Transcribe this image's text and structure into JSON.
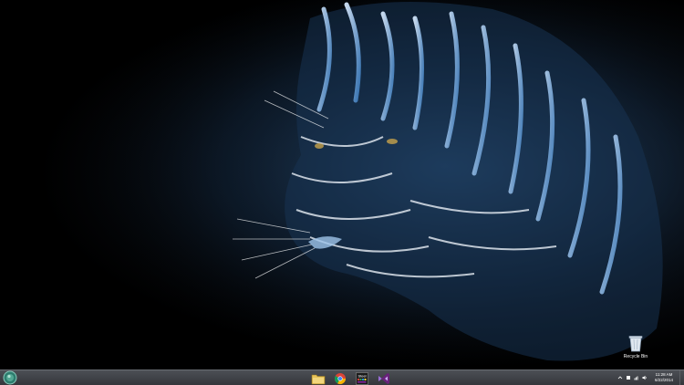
{
  "desktop": {
    "wallpaper": "fractal-tiger-icon",
    "icons": [
      {
        "label": "Recycle Bin",
        "icon": "recycle-bin-icon"
      }
    ]
  },
  "taskbar": {
    "start_icon": "windows-orb-icon",
    "pinned": [
      {
        "icon": "file-explorer-icon"
      },
      {
        "icon": "chrome-icon"
      },
      {
        "icon": "steel-app-icon",
        "text": "Steel"
      },
      {
        "icon": "visual-studio-icon"
      }
    ],
    "tray": {
      "icons": [
        "show-hidden-icon",
        "action-center-icon",
        "network-icon",
        "volume-icon"
      ],
      "time": "11:28 AM",
      "date": "6/22/2014"
    }
  },
  "colors": {
    "taskbar_top": "#4c4f55",
    "taskbar_bottom": "#35373c",
    "tiger_blue": "#3b6ea5",
    "tiger_white": "#e8eef5"
  }
}
